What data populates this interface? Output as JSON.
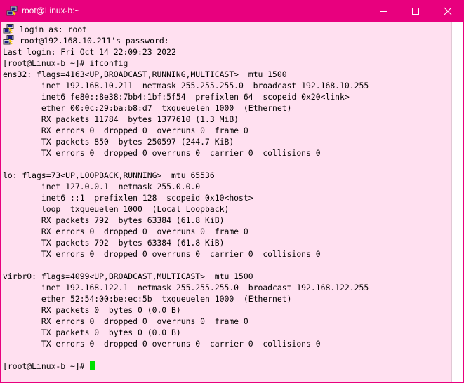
{
  "window": {
    "title": "root@Linux-b:~"
  },
  "colors": {
    "titlebar": "#e8007e",
    "terminal_bg": "#ffe0f0",
    "terminal_fg": "#000000",
    "cursor": "#00e000"
  },
  "icons": {
    "app": "putty-icon",
    "minimize": "minimize-icon",
    "maximize": "maximize-icon",
    "close": "close-icon"
  },
  "terminal": {
    "lines": [
      "login as: root",
      "root@192.168.10.211's password:",
      "Last login: Fri Oct 14 22:09:23 2022",
      "[root@Linux-b ~]# ifconfig",
      "ens32: flags=4163<UP,BROADCAST,RUNNING,MULTICAST>  mtu 1500",
      "        inet 192.168.10.211  netmask 255.255.255.0  broadcast 192.168.10.255",
      "        inet6 fe80::8e38:7bb4:1bf:5f54  prefixlen 64  scopeid 0x20<link>",
      "        ether 00:0c:29:ba:b8:d7  txqueuelen 1000  (Ethernet)",
      "        RX packets 11784  bytes 1377610 (1.3 MiB)",
      "        RX errors 0  dropped 0  overruns 0  frame 0",
      "        TX packets 850  bytes 250597 (244.7 KiB)",
      "        TX errors 0  dropped 0 overruns 0  carrier 0  collisions 0",
      "",
      "lo: flags=73<UP,LOOPBACK,RUNNING>  mtu 65536",
      "        inet 127.0.0.1  netmask 255.0.0.0",
      "        inet6 ::1  prefixlen 128  scopeid 0x10<host>",
      "        loop  txqueuelen 1000  (Local Loopback)",
      "        RX packets 792  bytes 63384 (61.8 KiB)",
      "        RX errors 0  dropped 0  overruns 0  frame 0",
      "        TX packets 792  bytes 63384 (61.8 KiB)",
      "        TX errors 0  dropped 0 overruns 0  carrier 0  collisions 0",
      "",
      "virbr0: flags=4099<UP,BROADCAST,MULTICAST>  mtu 1500",
      "        inet 192.168.122.1  netmask 255.255.255.0  broadcast 192.168.122.255",
      "        ether 52:54:00:be:ec:5b  txqueuelen 1000  (Ethernet)",
      "        RX packets 0  bytes 0 (0.0 B)",
      "        RX errors 0  dropped 0  overruns 0  frame 0",
      "        TX packets 0  bytes 0 (0.0 B)",
      "        TX errors 0  dropped 0 overruns 0  carrier 0  collisions 0",
      "",
      "[root@Linux-b ~]# "
    ]
  }
}
